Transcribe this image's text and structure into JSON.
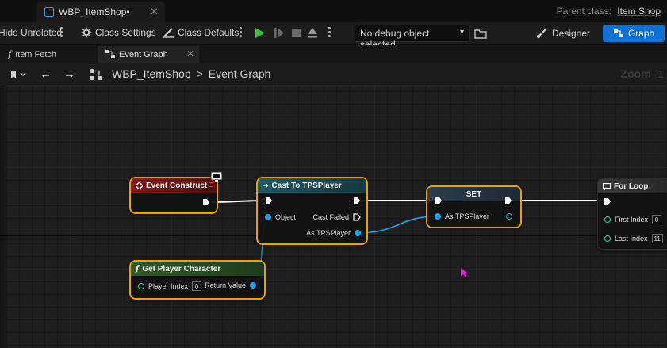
{
  "title_bar": {
    "doc_tab_label": "WBP_ItemShop•",
    "parent_class_label": "Parent class:",
    "parent_class_value": "Item Shop"
  },
  "toolbar": {
    "hide_unrelated_label": "Hide Unrelated",
    "class_settings_label": "Class Settings",
    "class_defaults_label": "Class Defaults",
    "debug_object_label": "No debug object selected",
    "designer_label": "Designer",
    "graph_label": "Graph"
  },
  "graph_tabs": [
    {
      "label": "Item Fetch"
    },
    {
      "label": "Event Graph"
    }
  ],
  "breadcrumb": {
    "blueprint": "WBP_ItemShop",
    "separator": ">",
    "graph": "Event Graph",
    "zoom": "Zoom -1"
  },
  "nodes": {
    "event_construct": {
      "title": "Event Construct"
    },
    "cast": {
      "title": "Cast To TPSPlayer",
      "object_label": "Object",
      "cast_failed_label": "Cast Failed",
      "as_player_label": "As TPSPlayer"
    },
    "set": {
      "title": "SET",
      "as_player_label": "As TPSPlayer"
    },
    "for_loop": {
      "title": "For Loop",
      "first_index_label": "First Index",
      "first_index_value": "0",
      "last_index_label": "Last Index",
      "last_index_value": "11"
    },
    "get_player": {
      "title": "Get Player Character",
      "player_index_label": "Player Index",
      "player_index_value": "0",
      "return_label": "Return Value"
    }
  },
  "colors": {
    "exec_wire": "#ffffff",
    "object_wire": "#1aa3e8",
    "selected_outline": "#e9a300",
    "graph_button": "#0f70d6"
  }
}
